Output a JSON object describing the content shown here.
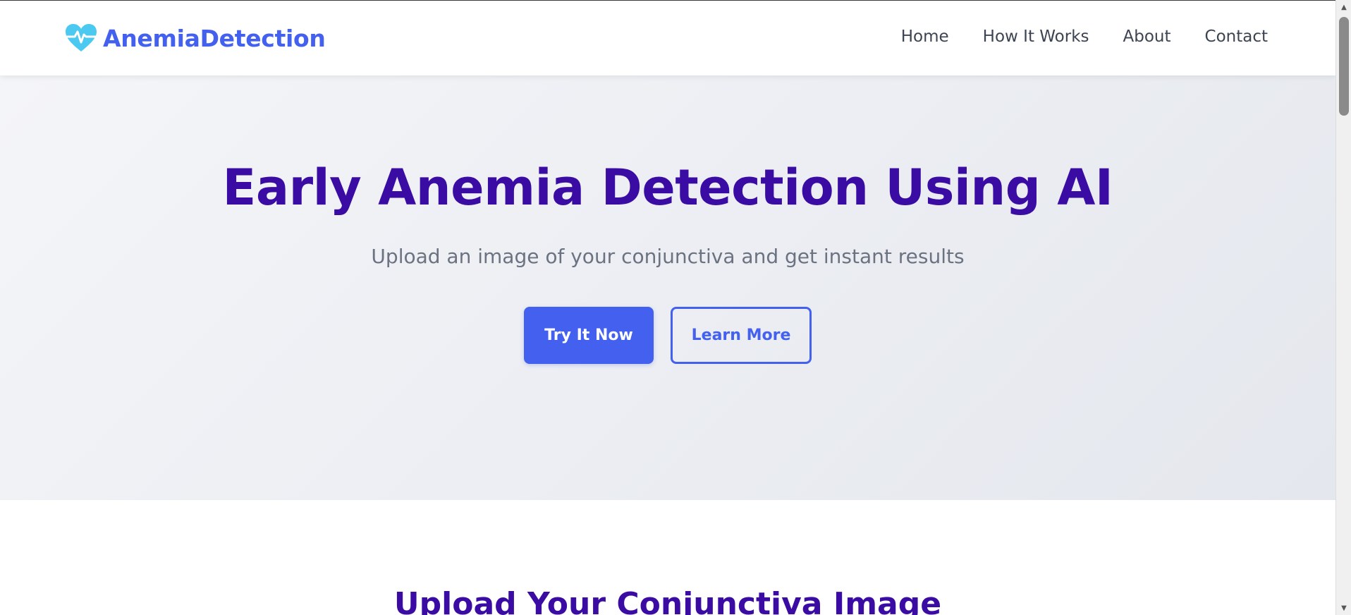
{
  "header": {
    "brand": "AnemiaDetection",
    "brand_icon": "heart-pulse-icon",
    "brand_color": "#4361ee",
    "icon_color": "#4cc9f0",
    "nav": [
      {
        "label": "Home"
      },
      {
        "label": "How It Works"
      },
      {
        "label": "About"
      },
      {
        "label": "Contact"
      }
    ]
  },
  "hero": {
    "title": "Early Anemia Detection Using AI",
    "subtitle": "Upload an image of your conjunctiva and get instant results",
    "primary_button": "Try It Now",
    "secondary_button": "Learn More",
    "title_color": "#3a0ca3"
  },
  "upload": {
    "title": "Upload Your Conjunctiva Image"
  },
  "scrollbar": {
    "up_icon": "scroll-up-arrow-icon",
    "down_icon": "scroll-down-arrow-icon"
  }
}
